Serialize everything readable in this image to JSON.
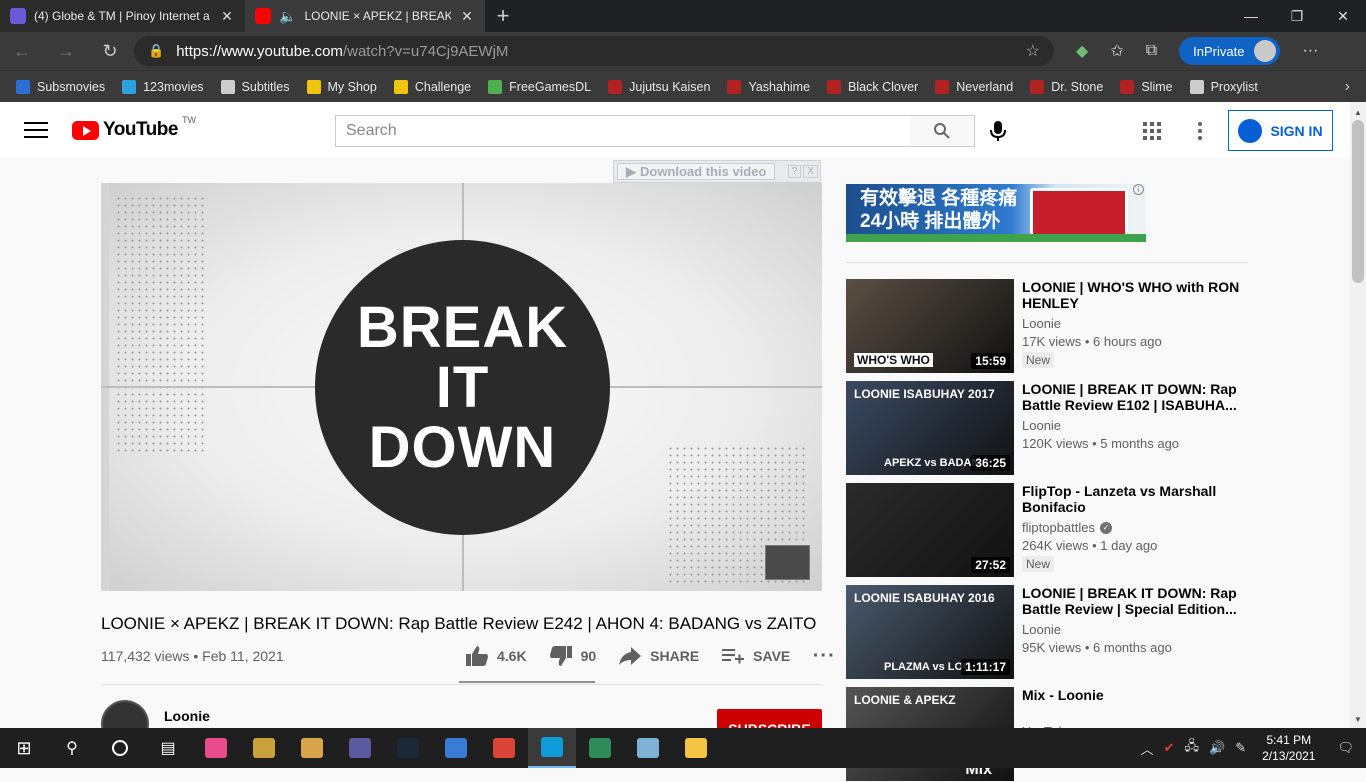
{
  "browser": {
    "tabs": [
      {
        "title": "(4) Globe & TM | Pinoy Internet a",
        "favicon": "globe-favicon",
        "active": false
      },
      {
        "title": "LOONIE × APEKZ | BREAK IT",
        "favicon": "youtube-favicon",
        "active": true,
        "audio_icon": "speaker-icon"
      }
    ],
    "url_host": "https://www.youtube.com",
    "url_path": "/watch?v=u74Cj9AEWjM",
    "inprivate_label": "InPrivate",
    "bookmarks": [
      {
        "label": "Subsmovies",
        "icon": "subsmovies-icon",
        "color": "#2c6ed5"
      },
      {
        "label": "123movies",
        "icon": "123movies-icon",
        "color": "#2e9fdf"
      },
      {
        "label": "Subtitles",
        "icon": "page-icon",
        "color": "#cccccc"
      },
      {
        "label": "My Shop",
        "icon": "pencil-icon",
        "color": "#f1c40f"
      },
      {
        "label": "Challenge",
        "icon": "pencil-icon",
        "color": "#f1c40f"
      },
      {
        "label": "FreeGamesDL",
        "icon": "gamepad-icon",
        "color": "#4caf50"
      },
      {
        "label": "Jujutsu Kaisen",
        "icon": "crunchyroll-icon",
        "color": "#b22222"
      },
      {
        "label": "Yashahime",
        "icon": "crunchyroll-icon",
        "color": "#b22222"
      },
      {
        "label": "Black Clover",
        "icon": "crunchyroll-icon",
        "color": "#b22222"
      },
      {
        "label": "Neverland",
        "icon": "crunchyroll-icon",
        "color": "#b22222"
      },
      {
        "label": "Dr. Stone",
        "icon": "crunchyroll-icon",
        "color": "#b22222"
      },
      {
        "label": "Slime",
        "icon": "crunchyroll-icon",
        "color": "#b22222"
      },
      {
        "label": "Proxylist",
        "icon": "page-icon",
        "color": "#cccccc"
      }
    ]
  },
  "youtube": {
    "logo_text": "YouTube",
    "logo_region": "TW",
    "search_placeholder": "Search",
    "signin_label": "SIGN IN",
    "download_bar": {
      "label": "Download this video",
      "help": "?",
      "close": "X"
    },
    "video": {
      "thumbnail_lines": [
        "BREAK",
        "IT",
        "DOWN"
      ],
      "title": "LOONIE × APEKZ | BREAK IT DOWN: Rap Battle Review E242 | AHON 4: BADANG vs ZAITO",
      "meta": "117,432 views • Feb 11, 2021",
      "likes": "4.6K",
      "dislikes": "90",
      "share_label": "SHARE",
      "save_label": "SAVE",
      "like_ratio": 0.98
    },
    "channel": {
      "name": "Loonie",
      "subscribe_label": "SUBSCRIBE"
    },
    "ad": {
      "line1": "有效擊退 各種疼痛",
      "line2": "24小時 排出體外",
      "info": "i"
    },
    "recommendations": [
      {
        "title": "LOONIE | WHO'S WHO with RON HENLEY",
        "channel": "Loonie",
        "views": "17K views • 6 hours ago",
        "badge": "New",
        "duration": "15:59",
        "overlay": "WHO'S WHO",
        "verified": false,
        "bg": "#5a4f44"
      },
      {
        "title": "LOONIE | BREAK IT DOWN: Rap Battle Review E102 | ISABUHA...",
        "channel": "Loonie",
        "views": "120K views • 5 months ago",
        "badge": "",
        "duration": "36:25",
        "overlay": "LOONIE ISABUHAY 2017",
        "overlay2": "APEKZ vs BADAN",
        "verified": false,
        "bg": "#3a4a63"
      },
      {
        "title": "FlipTop - Lanzeta vs Marshall Bonifacio",
        "channel": "fliptopbattles",
        "views": "264K views • 1 day ago",
        "badge": "New",
        "duration": "27:52",
        "overlay": "",
        "verified": true,
        "bg": "#2b2b2b"
      },
      {
        "title": "LOONIE | BREAK IT DOWN: Rap Battle Review | Special Edition...",
        "channel": "Loonie",
        "views": "95K views • 6 months ago",
        "badge": "",
        "duration": "1:11:17",
        "overlay": "LOONIE ISABUHAY 2016",
        "overlay2": "PLAZMA vs LOO",
        "verified": false,
        "bg": "#4a5a6e"
      },
      {
        "title": "Mix - Loonie",
        "channel": "YouTube",
        "views": "",
        "badge": "",
        "duration": "",
        "overlay": "LOONIE & APEKZ",
        "overlay2": "Mix",
        "verified": false,
        "bg": "#555555"
      }
    ]
  },
  "taskbar": {
    "apps": [
      {
        "name": "start-button",
        "color": "#ffffff"
      },
      {
        "name": "search-button",
        "color": "#ffffff"
      },
      {
        "name": "cortana-button",
        "color": "#ffffff"
      },
      {
        "name": "task-view-button",
        "color": "#ffffff"
      },
      {
        "name": "app-colorful",
        "color": "#e84c8a"
      },
      {
        "name": "app-game1",
        "color": "#c8a13a"
      },
      {
        "name": "app-game2",
        "color": "#d9a54a"
      },
      {
        "name": "app-game3",
        "color": "#5a5aa0"
      },
      {
        "name": "steam",
        "color": "#1b2838"
      },
      {
        "name": "app-globe",
        "color": "#3a7bd5"
      },
      {
        "name": "chrome",
        "color": "#db4437"
      },
      {
        "name": "edge",
        "color": "#0f9bd7",
        "active": true
      },
      {
        "name": "edge-dev",
        "color": "#2e8b57"
      },
      {
        "name": "app-notes",
        "color": "#7fb3d5"
      },
      {
        "name": "file-explorer",
        "color": "#f4c542"
      }
    ],
    "time": "5:41 PM",
    "date": "2/13/2021"
  }
}
